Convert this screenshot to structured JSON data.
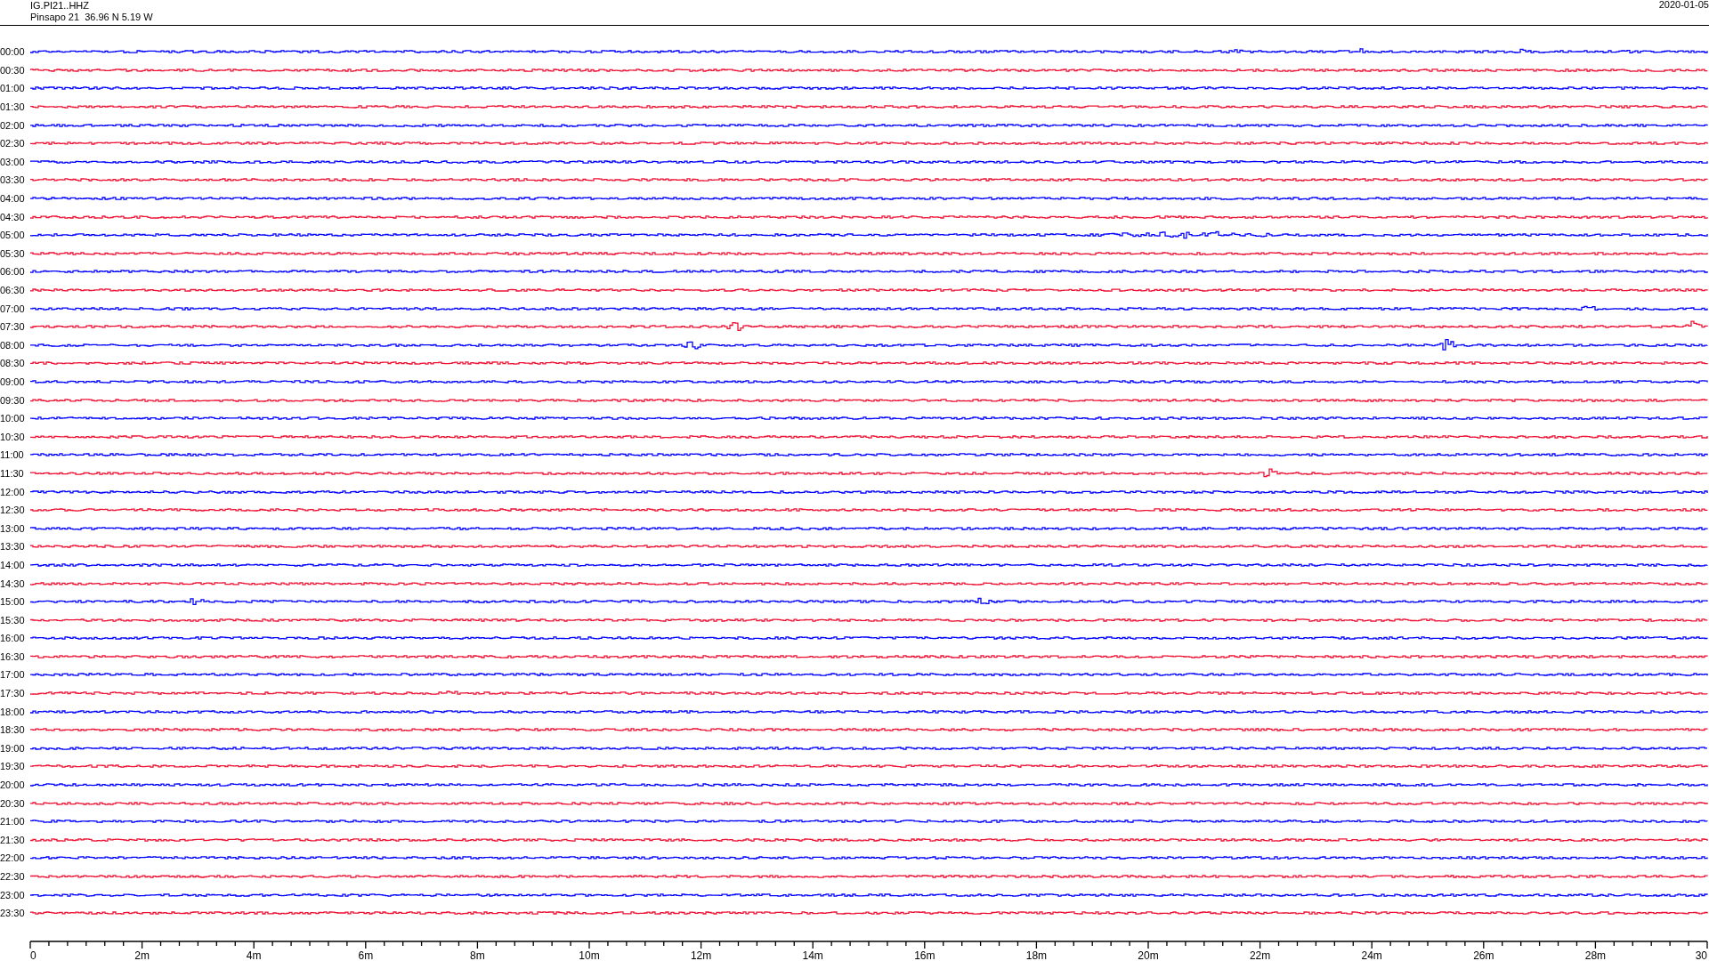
{
  "header": {
    "channel": "IG.PI21..HHZ",
    "station": "Pinsapo 21  36.96 N 5.19 W",
    "date": "2020-01-05"
  },
  "traces": [
    {
      "label": "00:00",
      "color": "#0000ff"
    },
    {
      "label": "00:30",
      "color": "#ee1133"
    },
    {
      "label": "01:00",
      "color": "#0000ff"
    },
    {
      "label": "01:30",
      "color": "#ee1133"
    },
    {
      "label": "02:00",
      "color": "#0000ff"
    },
    {
      "label": "02:30",
      "color": "#ee1133"
    },
    {
      "label": "03:00",
      "color": "#0000ff"
    },
    {
      "label": "03:30",
      "color": "#ee1133"
    },
    {
      "label": "04:00",
      "color": "#0000ff"
    },
    {
      "label": "04:30",
      "color": "#ee1133"
    },
    {
      "label": "05:00",
      "color": "#0000ff"
    },
    {
      "label": "05:30",
      "color": "#ee1133"
    },
    {
      "label": "06:00",
      "color": "#0000ff"
    },
    {
      "label": "06:30",
      "color": "#ee1133"
    },
    {
      "label": "07:00",
      "color": "#0000ff"
    },
    {
      "label": "07:30",
      "color": "#ee1133"
    },
    {
      "label": "08:00",
      "color": "#0000ff"
    },
    {
      "label": "08:30",
      "color": "#ee1133"
    },
    {
      "label": "09:00",
      "color": "#0000ff"
    },
    {
      "label": "09:30",
      "color": "#ee1133"
    },
    {
      "label": "10:00",
      "color": "#0000ff"
    },
    {
      "label": "10:30",
      "color": "#ee1133"
    },
    {
      "label": "11:00",
      "color": "#0000ff"
    },
    {
      "label": "11:30",
      "color": "#ee1133"
    },
    {
      "label": "12:00",
      "color": "#0000ff"
    },
    {
      "label": "12:30",
      "color": "#ee1133"
    },
    {
      "label": "13:00",
      "color": "#0000ff"
    },
    {
      "label": "13:30",
      "color": "#ee1133"
    },
    {
      "label": "14:00",
      "color": "#0000ff"
    },
    {
      "label": "14:30",
      "color": "#ee1133"
    },
    {
      "label": "15:00",
      "color": "#0000ff"
    },
    {
      "label": "15:30",
      "color": "#ee1133"
    },
    {
      "label": "16:00",
      "color": "#0000ff"
    },
    {
      "label": "16:30",
      "color": "#ee1133"
    },
    {
      "label": "17:00",
      "color": "#0000ff"
    },
    {
      "label": "17:30",
      "color": "#ee1133"
    },
    {
      "label": "18:00",
      "color": "#0000ff"
    },
    {
      "label": "18:30",
      "color": "#ee1133"
    },
    {
      "label": "19:00",
      "color": "#0000ff"
    },
    {
      "label": "19:30",
      "color": "#ee1133"
    },
    {
      "label": "20:00",
      "color": "#0000ff"
    },
    {
      "label": "20:30",
      "color": "#ee1133"
    },
    {
      "label": "21:00",
      "color": "#0000ff"
    },
    {
      "label": "21:30",
      "color": "#ee1133"
    },
    {
      "label": "22:00",
      "color": "#0000ff"
    },
    {
      "label": "22:30",
      "color": "#ee1133"
    },
    {
      "label": "23:00",
      "color": "#0000ff"
    },
    {
      "label": "23:30",
      "color": "#ee1133"
    }
  ],
  "time_axis": {
    "labels": [
      "0",
      "2m",
      "4m",
      "6m",
      "8m",
      "10m",
      "12m",
      "14m",
      "16m",
      "18m",
      "20m",
      "22m",
      "24m",
      "26m",
      "28m",
      "30"
    ]
  }
}
